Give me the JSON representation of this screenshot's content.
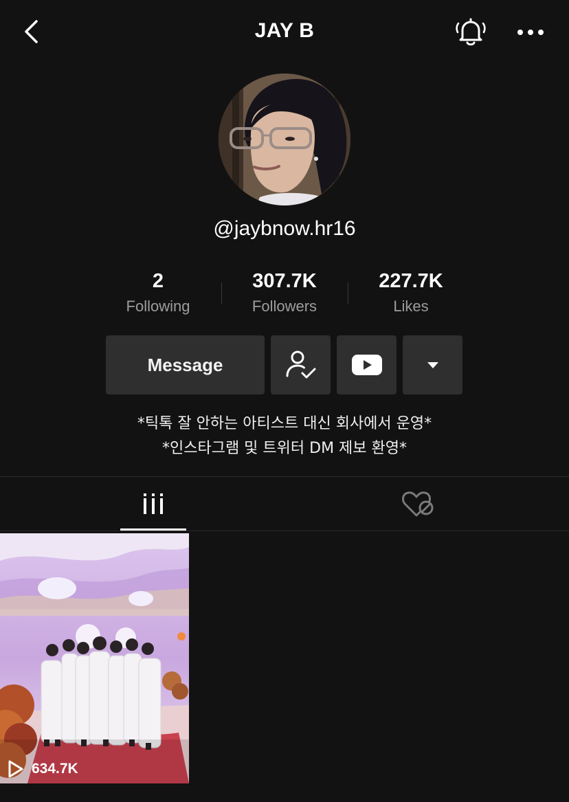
{
  "header": {
    "title": "JAY B",
    "icons": {
      "back": "chevron-left-icon",
      "bell": "bell-icon",
      "more": "more-horizontal-icon"
    }
  },
  "profile": {
    "username": "@jaybnow.hr16",
    "stats": [
      {
        "value": "2",
        "label": "Following"
      },
      {
        "value": "307.7K",
        "label": "Followers"
      },
      {
        "value": "227.7K",
        "label": "Likes"
      }
    ]
  },
  "actions": {
    "message_label": "Message",
    "icons": {
      "following": "user-check-icon",
      "youtube": "youtube-icon",
      "dropdown": "caret-down-icon"
    }
  },
  "bio": {
    "line1": "*틱톡 잘 안하는 아티스트 대신 회사에서 운영*",
    "line2": "*인스타그램 및 트위터 DM 제보 환영*"
  },
  "tabs": {
    "active": "videos",
    "icons": {
      "videos": "grid-icon",
      "liked": "private-liked-heart-icon"
    }
  },
  "videos": [
    {
      "views": "634.7K",
      "icon": "play-icon"
    }
  ],
  "colors": {
    "background": "#121212",
    "button_bg": "#2f2f2f",
    "secondary_text": "#9d9d9d",
    "divider": "#2e2e2e"
  }
}
